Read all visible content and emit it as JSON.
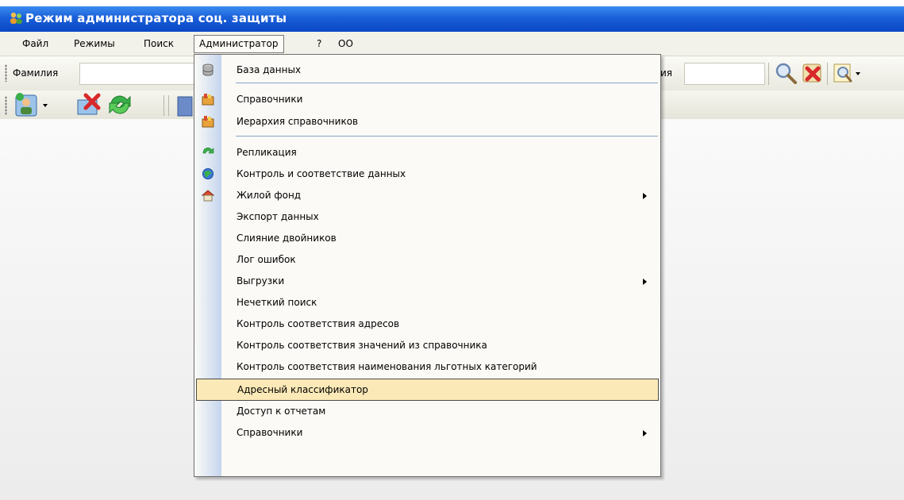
{
  "window": {
    "title": "Режим администратора соц. защиты"
  },
  "menubar": {
    "items": [
      {
        "label": "Файл"
      },
      {
        "label": "Режимы"
      },
      {
        "label": "Поиск"
      },
      {
        "label": "Администратор"
      },
      {
        "label": "?"
      },
      {
        "label": "ОО"
      }
    ],
    "active": "Администратор"
  },
  "toolbar": {
    "surname_label": "Фамилия",
    "name_label_partial": "ия",
    "surname_value": "",
    "name_value": ""
  },
  "dropdown": {
    "items": [
      {
        "label": "База данных",
        "icon": "database-icon"
      },
      {
        "label": "Справочники",
        "icon": "reference-books-icon"
      },
      {
        "label": "Иерархия справочников",
        "icon": "reference-hierarchy-icon"
      },
      {
        "label": "Репликация",
        "icon": "replication-icon"
      },
      {
        "label": "Контроль и соответствие данных",
        "icon": "data-control-icon"
      },
      {
        "label": "Жилой фонд",
        "icon": "housing-icon",
        "submenu": true
      },
      {
        "label": "Экспорт данных"
      },
      {
        "label": "Слияние двойников"
      },
      {
        "label": "Лог ошибок"
      },
      {
        "label": "Выгрузки",
        "submenu": true
      },
      {
        "label": "Нечеткий поиск"
      },
      {
        "label": "Контроль соответствия адресов"
      },
      {
        "label": "Контроль соответствия значений из справочника"
      },
      {
        "label": "Контроль соответствия наименования льготных категорий"
      },
      {
        "label": "Адресный классификатор",
        "selected": true
      },
      {
        "label": "Доступ к отчетам"
      },
      {
        "label": "Справочники",
        "submenu": true
      }
    ]
  },
  "colors": {
    "titlebar": "#1a5fd8",
    "menu_highlight": "#fbe9b7",
    "gutter": "#c5d5ee"
  }
}
